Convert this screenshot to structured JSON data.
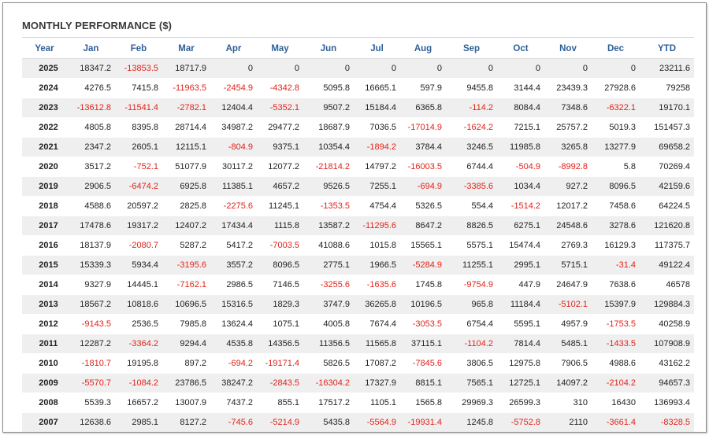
{
  "title": "MONTHLY PERFORMANCE ($)",
  "colors": {
    "header_text": "#2e5f96",
    "negative": "#e2231a",
    "row_alt": "#efefef"
  },
  "columns": [
    "Year",
    "Jan",
    "Feb",
    "Mar",
    "Apr",
    "May",
    "Jun",
    "Jul",
    "Aug",
    "Sep",
    "Oct",
    "Nov",
    "Dec",
    "YTD"
  ],
  "rows": [
    {
      "year": "2025",
      "values": [
        "18347.2",
        "-13853.5",
        "18717.9",
        "0",
        "0",
        "0",
        "0",
        "0",
        "0",
        "0",
        "0",
        "0",
        "23211.6"
      ]
    },
    {
      "year": "2024",
      "values": [
        "4276.5",
        "7415.8",
        "-11963.5",
        "-2454.9",
        "-4342.8",
        "5095.8",
        "16665.1",
        "597.9",
        "9455.8",
        "3144.4",
        "23439.3",
        "27928.6",
        "79258"
      ]
    },
    {
      "year": "2023",
      "values": [
        "-13612.8",
        "-11541.4",
        "-2782.1",
        "12404.4",
        "-5352.1",
        "9507.2",
        "15184.4",
        "6365.8",
        "-114.2",
        "8084.4",
        "7348.6",
        "-6322.1",
        "19170.1"
      ]
    },
    {
      "year": "2022",
      "values": [
        "4805.8",
        "8395.8",
        "28714.4",
        "34987.2",
        "29477.2",
        "18687.9",
        "7036.5",
        "-17014.9",
        "-1624.2",
        "7215.1",
        "25757.2",
        "5019.3",
        "151457.3"
      ]
    },
    {
      "year": "2021",
      "values": [
        "2347.2",
        "2605.1",
        "12115.1",
        "-804.9",
        "9375.1",
        "10354.4",
        "-1894.2",
        "3784.4",
        "3246.5",
        "11985.8",
        "3265.8",
        "13277.9",
        "69658.2"
      ]
    },
    {
      "year": "2020",
      "values": [
        "3517.2",
        "-752.1",
        "51077.9",
        "30117.2",
        "12077.2",
        "-21814.2",
        "14797.2",
        "-16003.5",
        "6744.4",
        "-504.9",
        "-8992.8",
        "5.8",
        "70269.4"
      ]
    },
    {
      "year": "2019",
      "values": [
        "2906.5",
        "-6474.2",
        "6925.8",
        "11385.1",
        "4657.2",
        "9526.5",
        "7255.1",
        "-694.9",
        "-3385.6",
        "1034.4",
        "927.2",
        "8096.5",
        "42159.6"
      ]
    },
    {
      "year": "2018",
      "values": [
        "4588.6",
        "20597.2",
        "2825.8",
        "-2275.6",
        "11245.1",
        "-1353.5",
        "4754.4",
        "5326.5",
        "554.4",
        "-1514.2",
        "12017.2",
        "7458.6",
        "64224.5"
      ]
    },
    {
      "year": "2017",
      "values": [
        "17478.6",
        "19317.2",
        "12407.2",
        "17434.4",
        "1115.8",
        "13587.2",
        "-11295.6",
        "8647.2",
        "8826.5",
        "6275.1",
        "24548.6",
        "3278.6",
        "121620.8"
      ]
    },
    {
      "year": "2016",
      "values": [
        "18137.9",
        "-2080.7",
        "5287.2",
        "5417.2",
        "-7003.5",
        "41088.6",
        "1015.8",
        "15565.1",
        "5575.1",
        "15474.4",
        "2769.3",
        "16129.3",
        "117375.7"
      ]
    },
    {
      "year": "2015",
      "values": [
        "15339.3",
        "5934.4",
        "-3195.6",
        "3557.2",
        "8096.5",
        "2775.1",
        "1966.5",
        "-5284.9",
        "11255.1",
        "2995.1",
        "5715.1",
        "-31.4",
        "49122.4"
      ]
    },
    {
      "year": "2014",
      "values": [
        "9327.9",
        "14445.1",
        "-7162.1",
        "2986.5",
        "7146.5",
        "-3255.6",
        "-1635.6",
        "1745.8",
        "-9754.9",
        "447.9",
        "24647.9",
        "7638.6",
        "46578"
      ]
    },
    {
      "year": "2013",
      "values": [
        "18567.2",
        "10818.6",
        "10696.5",
        "15316.5",
        "1829.3",
        "3747.9",
        "36265.8",
        "10196.5",
        "965.8",
        "11184.4",
        "-5102.1",
        "15397.9",
        "129884.3"
      ]
    },
    {
      "year": "2012",
      "values": [
        "-9143.5",
        "2536.5",
        "7985.8",
        "13624.4",
        "1075.1",
        "4005.8",
        "7674.4",
        "-3053.5",
        "6754.4",
        "5595.1",
        "4957.9",
        "-1753.5",
        "40258.9"
      ]
    },
    {
      "year": "2011",
      "values": [
        "12287.2",
        "-3364.2",
        "9294.4",
        "4535.8",
        "14356.5",
        "11356.5",
        "11565.8",
        "37115.1",
        "-1104.2",
        "7814.4",
        "5485.1",
        "-1433.5",
        "107908.9"
      ]
    },
    {
      "year": "2010",
      "values": [
        "-1810.7",
        "19195.8",
        "897.2",
        "-694.2",
        "-19171.4",
        "5826.5",
        "17087.2",
        "-7845.6",
        "3806.5",
        "12975.8",
        "7906.5",
        "4988.6",
        "43162.2"
      ]
    },
    {
      "year": "2009",
      "values": [
        "-5570.7",
        "-1084.2",
        "23786.5",
        "38247.2",
        "-2843.5",
        "-16304.2",
        "17327.9",
        "8815.1",
        "7565.1",
        "12725.1",
        "14097.2",
        "-2104.2",
        "94657.3"
      ]
    },
    {
      "year": "2008",
      "values": [
        "5539.3",
        "16657.2",
        "13007.9",
        "7437.2",
        "855.1",
        "17517.2",
        "1105.1",
        "1565.8",
        "29969.3",
        "26599.3",
        "310",
        "16430",
        "136993.4"
      ]
    },
    {
      "year": "2007",
      "values": [
        "12638.6",
        "2985.1",
        "8127.2",
        "-745.6",
        "-5214.9",
        "5435.8",
        "-5564.9",
        "-19931.4",
        "1245.8",
        "-5752.8",
        "2110",
        "-3661.4",
        "-8328.5"
      ]
    }
  ]
}
